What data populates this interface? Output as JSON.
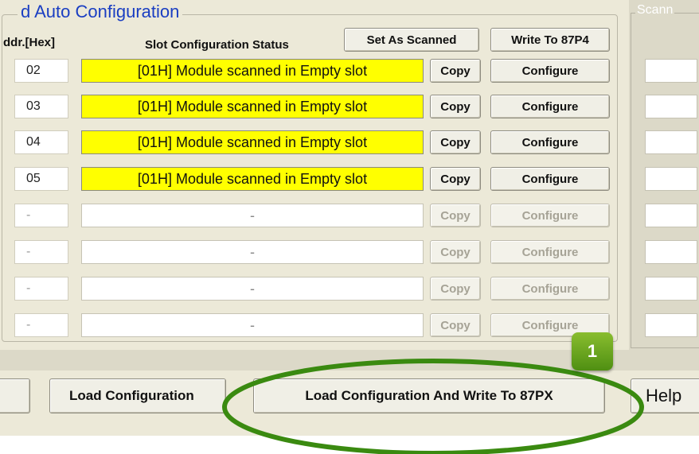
{
  "group": {
    "title": "d Auto Configuration",
    "addr_header": "ddr.[Hex]",
    "status_header": "Slot Configuration Status",
    "set_as_scanned": "Set As Scanned",
    "write_to": "Write To 87P4"
  },
  "slots": [
    {
      "addr": "02",
      "status": "[01H] Module scanned in Empty slot",
      "copy": "Copy",
      "configure": "Configure",
      "active": true
    },
    {
      "addr": "03",
      "status": "[01H] Module scanned in Empty slot",
      "copy": "Copy",
      "configure": "Configure",
      "active": true
    },
    {
      "addr": "04",
      "status": "[01H] Module scanned in Empty slot",
      "copy": "Copy",
      "configure": "Configure",
      "active": true
    },
    {
      "addr": "05",
      "status": "[01H] Module scanned in Empty slot",
      "copy": "Copy",
      "configure": "Configure",
      "active": true
    },
    {
      "addr": "-",
      "status": "-",
      "copy": "Copy",
      "configure": "Configure",
      "active": false
    },
    {
      "addr": "-",
      "status": "-",
      "copy": "Copy",
      "configure": "Configure",
      "active": false
    },
    {
      "addr": "-",
      "status": "-",
      "copy": "Copy",
      "configure": "Configure",
      "active": false
    },
    {
      "addr": "-",
      "status": "-",
      "copy": "Copy",
      "configure": "Configure",
      "active": false
    }
  ],
  "scan_panel": {
    "title": "Scann"
  },
  "bottom": {
    "load_configuration": "Load Configuration",
    "load_and_write": "Load  Configuration And Write To 87PX",
    "help": "Help"
  },
  "callout": {
    "number": "1",
    "ellipse_color": "#3a8a10",
    "badge_color": "#6aa81f"
  },
  "colors": {
    "active_status_bg": "#ffff00",
    "title_color": "#1a3ec2"
  }
}
